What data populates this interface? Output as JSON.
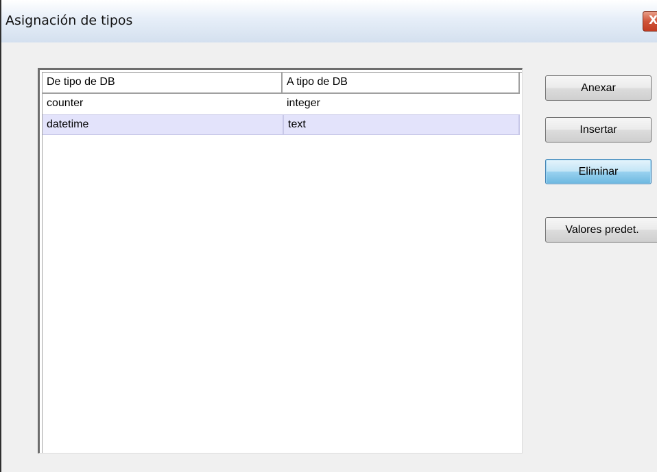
{
  "window": {
    "title": "Asignación de tipos",
    "close_glyph": "X"
  },
  "table": {
    "columns": [
      "De tipo de DB",
      "A tipo de DB"
    ],
    "rows": [
      {
        "from": "counter",
        "to": "integer",
        "selected": false
      },
      {
        "from": "datetime",
        "to": "text",
        "selected": true
      }
    ]
  },
  "buttons": {
    "append_label": "Anexar",
    "insert_label": "Insertar",
    "delete_label": "Eliminar",
    "defaults_label": "Valores predet."
  },
  "colors": {
    "selected_row": "#e3e3fb",
    "focused_button": "#98d1ef",
    "close_button": "#c23b22"
  }
}
